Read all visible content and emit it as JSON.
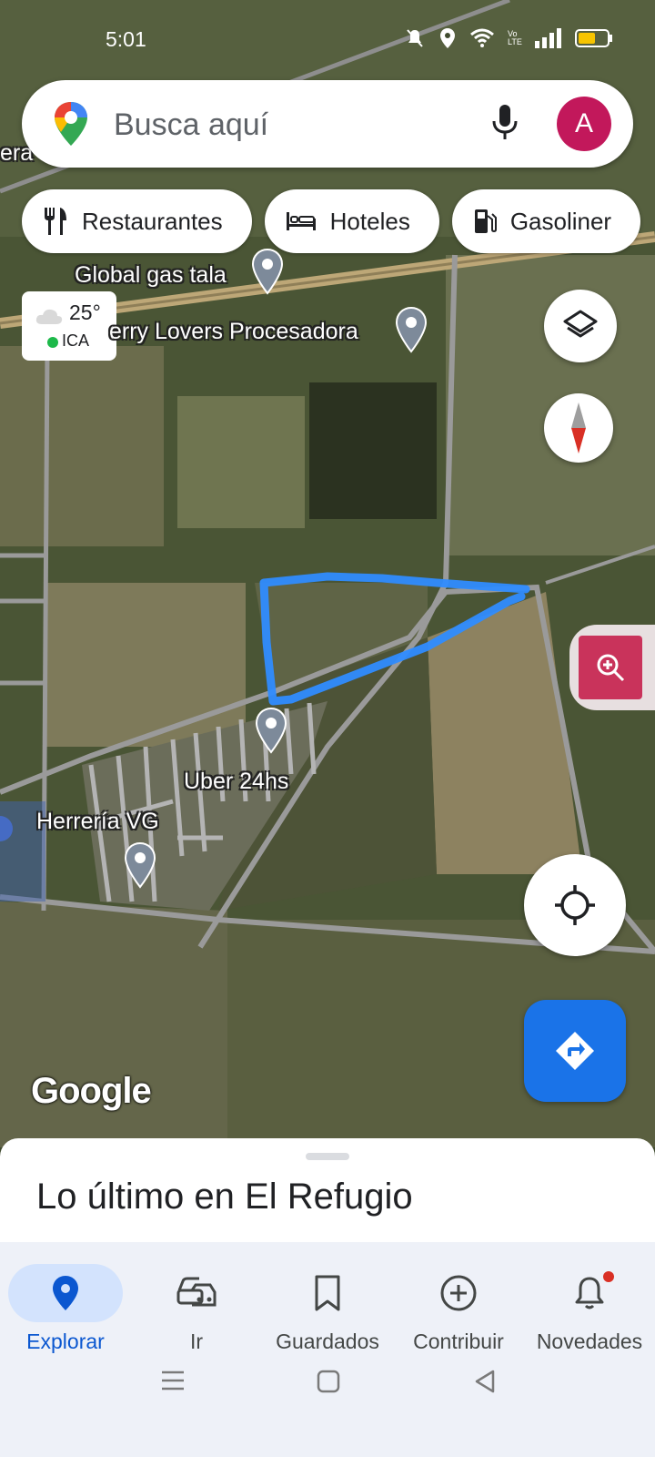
{
  "status_bar": {
    "time": "5:01",
    "volte_label": "Vo LTE"
  },
  "search": {
    "placeholder": "Busca aquí",
    "avatar_letter": "A"
  },
  "chips": [
    {
      "label": "Restaurantes",
      "icon": "fork-knife-icon"
    },
    {
      "label": "Hoteles",
      "icon": "bed-icon"
    },
    {
      "label": "Gasoliner",
      "icon": "gas-station-icon"
    }
  ],
  "weather": {
    "temperature": "25°",
    "air_quality": "ICA"
  },
  "places": [
    {
      "name": "Global gas tala"
    },
    {
      "name": "erry Lovers Procesadora"
    },
    {
      "name": "Uber 24hs"
    },
    {
      "name": "Herrería VG"
    }
  ],
  "map_edge_text": "era",
  "attribution": "Google",
  "sheet": {
    "title": "Lo último en El Refugio"
  },
  "nav": {
    "items": [
      {
        "label": "Explorar",
        "icon": "explore-pin-icon",
        "active": true
      },
      {
        "label": "Ir",
        "icon": "commute-car-icon",
        "active": false
      },
      {
        "label": "Guardados",
        "icon": "bookmark-icon",
        "active": false
      },
      {
        "label": "Contribuir",
        "icon": "add-circle-icon",
        "active": false
      },
      {
        "label": "Novedades",
        "icon": "bell-icon",
        "active": false
      }
    ]
  },
  "colors": {
    "accent": "#1a73e8",
    "avatar": "#c2185b",
    "drawn_path": "#2f8cff",
    "nav_active": "#0b57d0"
  }
}
